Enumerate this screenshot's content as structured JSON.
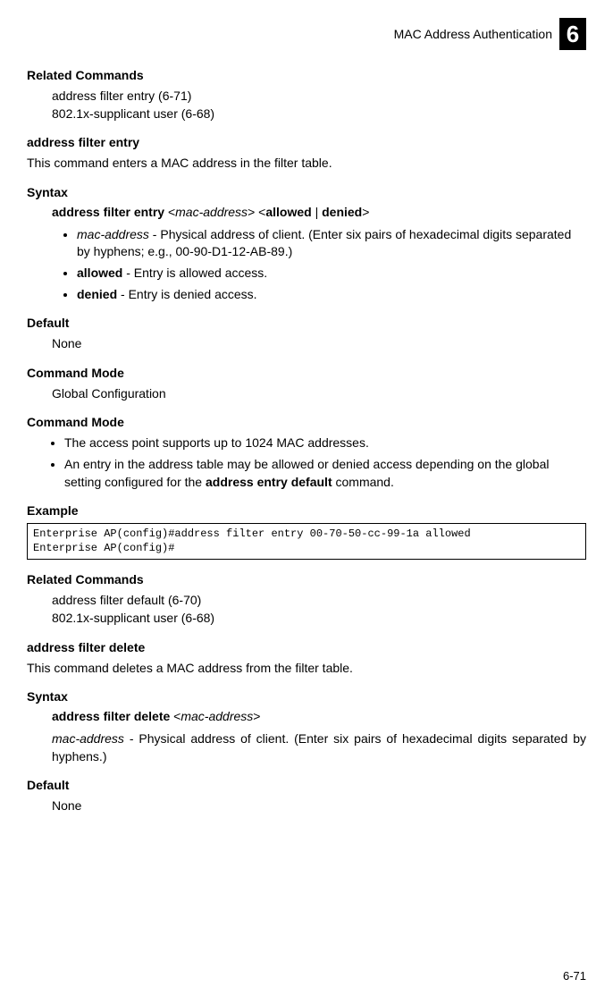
{
  "header": {
    "title": "MAC Address Authentication",
    "chapter": "6"
  },
  "s1": {
    "heading": "Related Commands",
    "line1": "address filter entry (6-71)",
    "line2": "802.1x-supplicant user (6-68)"
  },
  "cmd1": {
    "title": "address filter entry",
    "desc": "This command enters a MAC address in the filter table.",
    "syntaxHeading": "Syntax",
    "syntaxCommand": "address filter entry",
    "syntaxParam": "<mac-address>",
    "syntaxAllowed": "allowed",
    "syntaxDenied": "denied",
    "bullets": {
      "b1param": "mac-address",
      "b1text": " - Physical address of client. (Enter six pairs of hexadecimal digits separated by hyphens; e.g., 00-90-D1-12-AB-89.)",
      "b2kw": "allowed",
      "b2text": " - Entry is allowed access.",
      "b3kw": "denied",
      "b3text": " - Entry is denied access."
    },
    "defaultHeading": "Default",
    "defaultValue": "None",
    "modeHeading": "Command Mode",
    "modeValue": "Global Configuration",
    "mode2Heading": "Command Mode",
    "mode2Bullets": {
      "b1": "The access point supports up to 1024 MAC addresses.",
      "b2a": "An entry in the address table may be allowed or denied access depending on the global setting configured for the ",
      "b2kw": "address entry default",
      "b2b": " command."
    },
    "exampleHeading": "Example",
    "code": "Enterprise AP(config)#address filter entry 00-70-50-cc-99-1a allowed\nEnterprise AP(config)#"
  },
  "s2": {
    "heading": "Related Commands",
    "line1": "address filter default (6-70)",
    "line2": "802.1x-supplicant user (6-68)"
  },
  "cmd2": {
    "title": "address filter delete",
    "desc": "This command deletes a MAC address from the filter table.",
    "syntaxHeading": "Syntax",
    "syntaxCommand": "address filter delete",
    "syntaxParam": "<mac-address>",
    "paramPre": "mac-address",
    "paramText": " - Physical address of client. (Enter six pairs of hexadecimal digits separated by hyphens.)",
    "defaultHeading": "Default",
    "defaultValue": "None"
  },
  "pageNumber": "6-71"
}
